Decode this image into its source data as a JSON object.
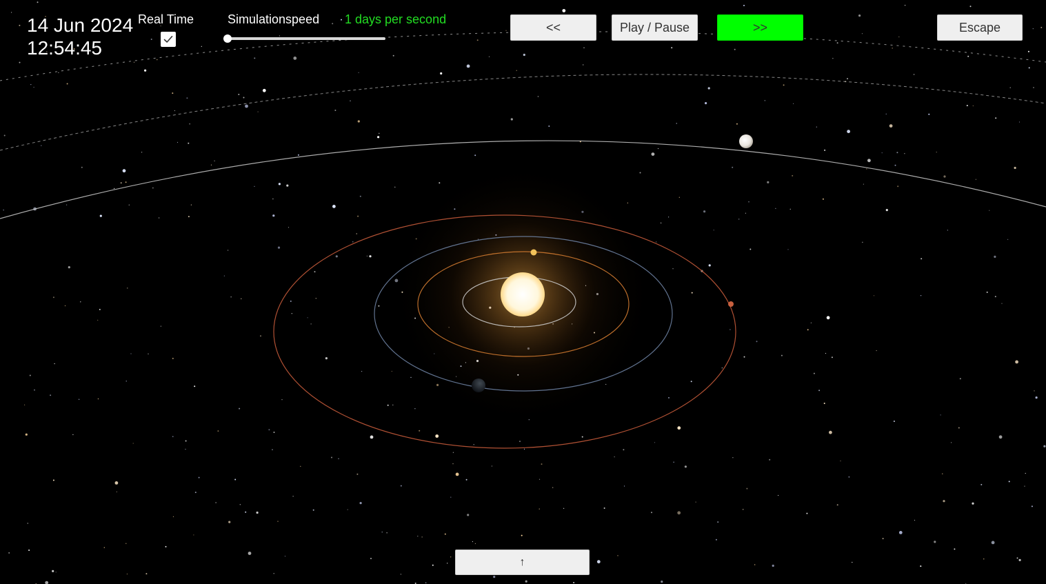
{
  "clock": {
    "date": "14 Jun 2024",
    "time": "12:54:45"
  },
  "controls": {
    "realtime_label": "Real Time",
    "realtime_checked": true,
    "simspeed_label": "Simulationspeed",
    "speed_text": "1 days per second",
    "speed_text_color": "#22dd22",
    "slider_value": 0.0
  },
  "buttons": {
    "rewind": "<<",
    "play_pause": "Play / Pause",
    "fast_forward": ">>",
    "fast_forward_color": "#00ff00",
    "escape": "Escape",
    "up_arrow": "↑"
  },
  "scene": {
    "background_color": "#000000",
    "sun_color": "#fff8e0",
    "orbit_colors": {
      "mercury": "#c8c8c8",
      "venus": "#d07a30",
      "earth": "#6b7fa0",
      "mars": "#c45a3a",
      "outer": "#cccccc"
    }
  }
}
